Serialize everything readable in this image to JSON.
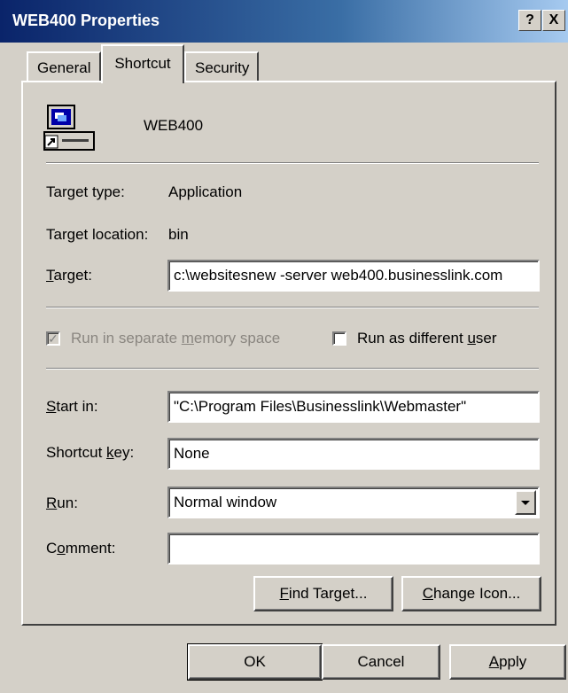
{
  "window": {
    "title": "WEB400 Properties",
    "help_label": "?",
    "close_label": "X"
  },
  "tabs": [
    {
      "label": "General"
    },
    {
      "label": "Shortcut"
    },
    {
      "label": "Security"
    }
  ],
  "shortcut": {
    "name": "WEB400",
    "target_type_label": "Target type:",
    "target_type_value": "Application",
    "target_location_label": "Target location:",
    "target_location_value": "bin",
    "target_label_ul": "T",
    "target_label_rest": "arget:",
    "target_value": "c:\\websitesnew -server web400.businesslink.com",
    "sep_memory_pre": "Run in separate ",
    "sep_memory_ul": "m",
    "sep_memory_post": "emory space",
    "diff_user_pre": "Run as different ",
    "diff_user_ul": "u",
    "diff_user_post": "ser",
    "start_in_ul": "S",
    "start_in_rest": "tart in:",
    "start_in_value": "\"C:\\Program Files\\Businesslink\\Webmaster\"",
    "shortcut_key_pre": "Shortcut ",
    "shortcut_key_ul": "k",
    "shortcut_key_post": "ey:",
    "shortcut_key_value": "None",
    "run_ul": "R",
    "run_rest": "un:",
    "run_value": "Normal window",
    "comment_pre": "C",
    "comment_ul": "o",
    "comment_post": "mment:",
    "comment_value": "",
    "find_target_ul": "F",
    "find_target_rest": "ind Target...",
    "change_icon_ul": "C",
    "change_icon_rest": "hange Icon..."
  },
  "footer": {
    "ok_label": "OK",
    "cancel_label": "Cancel",
    "apply_ul": "A",
    "apply_rest": "pply"
  },
  "colors": {
    "title_bar": "#0a246a",
    "face": "#d4d0c8"
  }
}
